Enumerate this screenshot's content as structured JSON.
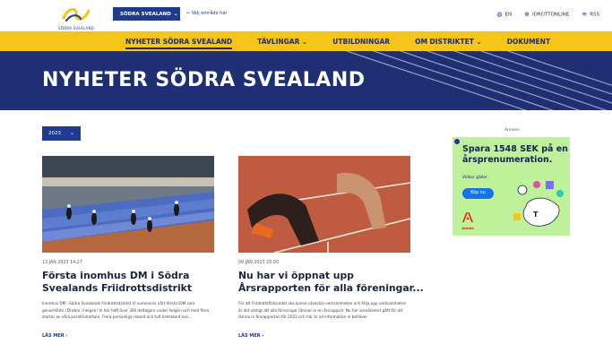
{
  "header": {
    "logo_text": "SÖDRA SVEALAND",
    "region_label": "SÖDRA SVEALAND",
    "choose_area": "← Välj område här",
    "lang": "EN",
    "login": "IDROTTONLINE",
    "rss": "RSS"
  },
  "nav": {
    "items": [
      {
        "label": "NYHETER SÖDRA SVEALAND"
      },
      {
        "label": "TÄVLINGAR ⌄"
      },
      {
        "label": "UTBILDNINGAR"
      },
      {
        "label": "OM DISTRIKTET ⌄"
      },
      {
        "label": "DOKUMENT"
      }
    ]
  },
  "hero": {
    "title": "NYHETER SÖDRA SVEALAND"
  },
  "filter": {
    "year": "2023"
  },
  "articles": [
    {
      "date": "13 JAN 2023 14:27",
      "title_line1": "Första inomhus DM i Södra",
      "title_line2": "Svealands Friidrottsdistrikt",
      "excerpt": "Inomhus DM i Södra Svealands Friidrottsdistrikt Vi summerar vårt första IDM som genomförts i Örebro i helgen! Vi har haft över 300 deltagare under helgen och med flera starter av våra parafriidrottare. Flera personliga rekord och två hallrekord kan...",
      "read_more": "LÄS MER ›"
    },
    {
      "date": "09 JAN 2023 23:00",
      "title_line1": "Nu har vi öppnat upp",
      "title_line2": "Årsrapporten för alla föreningar...",
      "excerpt": "För att Friidrottsförbundet ska kunna utveckla verksamheten och följa upp verksamheten är det viktigt att alla föreningar lämnar in en årsrapport. Nu har anmälantet gått för att lämna in årsrapporten för 2022 och här är all information ni behöver.",
      "read_more": "LÄS MER ›"
    }
  ],
  "ad": {
    "label": "Annons",
    "headline": "Spara 1548 SEK på en årsprenumeration.",
    "sub": "Villkor gäller.",
    "cta": "Köp nu",
    "brand": "Adobe"
  },
  "colors": {
    "navy": "#1f2f73",
    "yellow": "#f5c518",
    "blue": "#1f3a8f",
    "ad_green": "#bff09a"
  }
}
